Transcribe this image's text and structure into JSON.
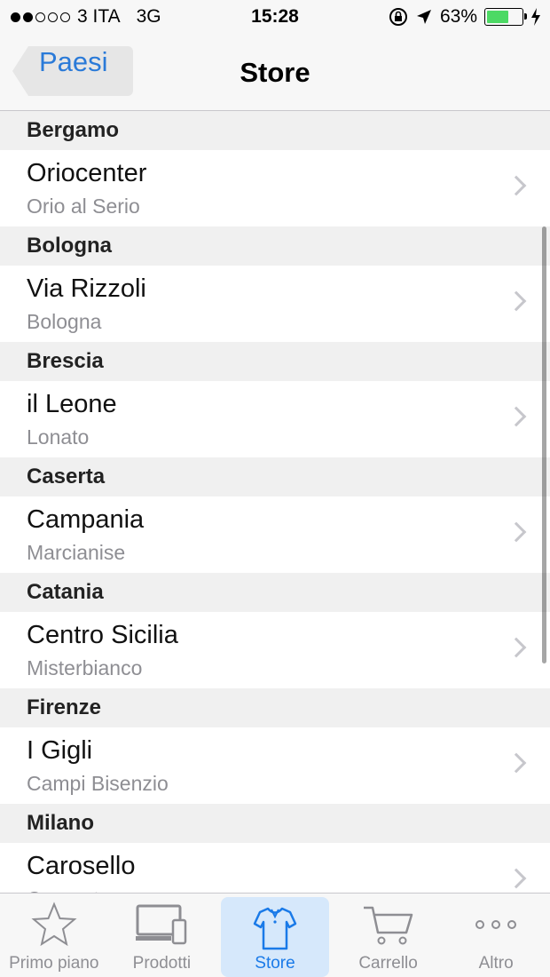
{
  "status_bar": {
    "carrier": "3 ITA",
    "network": "3G",
    "time": "15:28",
    "battery": "63%",
    "battery_level": 0.63,
    "battery_color": "#4cd964"
  },
  "nav": {
    "back_label": "Paesi",
    "title": "Store"
  },
  "sections": [
    {
      "header": "Bergamo",
      "title": "Oriocenter",
      "subtitle": "Orio al Serio"
    },
    {
      "header": "Bologna",
      "title": "Via Rizzoli",
      "subtitle": "Bologna"
    },
    {
      "header": "Brescia",
      "title": "il Leone",
      "subtitle": "Lonato"
    },
    {
      "header": "Caserta",
      "title": "Campania",
      "subtitle": "Marcianise"
    },
    {
      "header": "Catania",
      "title": "Centro Sicilia",
      "subtitle": "Misterbianco"
    },
    {
      "header": "Firenze",
      "title": "I Gigli",
      "subtitle": "Campi Bisenzio"
    },
    {
      "header": "Milano",
      "title": "Carosello",
      "subtitle": "Carugate"
    }
  ],
  "tabs": [
    {
      "label": "Primo piano",
      "icon": "star-icon"
    },
    {
      "label": "Prodotti",
      "icon": "devices-icon"
    },
    {
      "label": "Store",
      "icon": "shirt-icon",
      "active": true
    },
    {
      "label": "Carrello",
      "icon": "cart-icon"
    },
    {
      "label": "Altro",
      "icon": "more-icon"
    }
  ],
  "colors": {
    "accent": "#2a7ad8",
    "active_tab_bg": "#d6e8fb"
  }
}
